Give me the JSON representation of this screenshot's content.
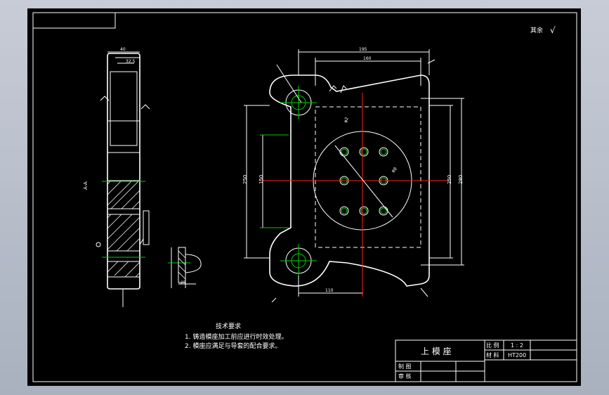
{
  "roughness_note": "其余",
  "roughness_symbol": "√",
  "tech": {
    "title": "技术要求",
    "item1": "1. 铸造模座加工前应进行时效处理。",
    "item2": "2. 模座应满足与导套的配合要求。"
  },
  "title_block": {
    "part_name": "上 模 座",
    "scale_label": "比 例",
    "scale_value": "1 : 2",
    "material_label": "材 料",
    "material_value": "HT200",
    "drawn_label": "制 图",
    "checked_label": "审 核"
  },
  "dims": {
    "top_width": "195",
    "top_inner": "160",
    "left_height": "250",
    "left_inner": "150",
    "right_h1": "250",
    "right_h2": "280",
    "bottom": "110",
    "side_a": "40",
    "side_b": "32.5",
    "section_label": "A-A",
    "small_25": "25",
    "diam1": "φ2",
    "diam2": "φ8"
  },
  "colors": {
    "background": "#000000",
    "line": "#ffffff",
    "centerline": "#ff2020",
    "hole": "#00d000"
  }
}
